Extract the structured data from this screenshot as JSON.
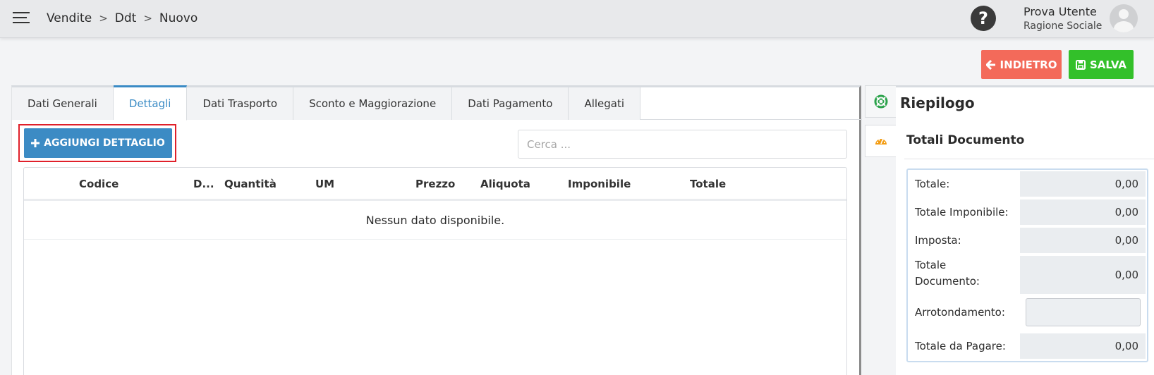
{
  "breadcrumb": [
    "Vendite",
    "Ddt",
    "Nuovo"
  ],
  "breadcrumb_separator": ">",
  "user": {
    "name": "Prova Utente",
    "company": "Ragione Sociale"
  },
  "help_symbol": "?",
  "actions": {
    "back_label": "INDIETRO",
    "save_label": "SALVA"
  },
  "tabs": [
    "Dati Generali",
    "Dettagli",
    "Dati Trasporto",
    "Sconto e Maggiorazione",
    "Dati Pagamento",
    "Allegati"
  ],
  "active_tab": "Dettagli",
  "add_button_label": "AGGIUNGI DETTAGLIO",
  "search": {
    "placeholder": "Cerca ...",
    "value": ""
  },
  "table": {
    "columns": [
      "Codice",
      "D...",
      "Quantità",
      "UM",
      "Prezzo",
      "Aliquota",
      "Imponibile",
      "Totale"
    ],
    "empty_message": "Nessun dato disponibile."
  },
  "summary": {
    "title": "Riepilogo",
    "section_title": "Totali Documento",
    "rows": [
      {
        "label": "Totale:",
        "value": "0,00"
      },
      {
        "label": "Totale Imponibile:",
        "value": "0,00"
      },
      {
        "label": "Imposta:",
        "value": "0,00"
      },
      {
        "label": "Totale Documento:",
        "value": "0,00"
      },
      {
        "label": "Arrotondamento:",
        "value": ""
      },
      {
        "label": "Totale da Pagare:",
        "value": "0,00"
      }
    ]
  },
  "icons": {
    "menu": "hamburger-icon",
    "help": "help-circle-icon",
    "back": "arrow-left-icon",
    "save": "floppy-disk-icon",
    "add": "plus-icon",
    "side_tab_1": "lifebuoy-icon",
    "side_tab_2": "dashboard-icon"
  },
  "colors": {
    "back_button": "#f36a5a",
    "save_button": "#33c02a",
    "primary": "#3c8bc4",
    "highlight": "#e0202a",
    "lifebuoy": "#2aa24a",
    "dashboard": "#f39c12"
  }
}
